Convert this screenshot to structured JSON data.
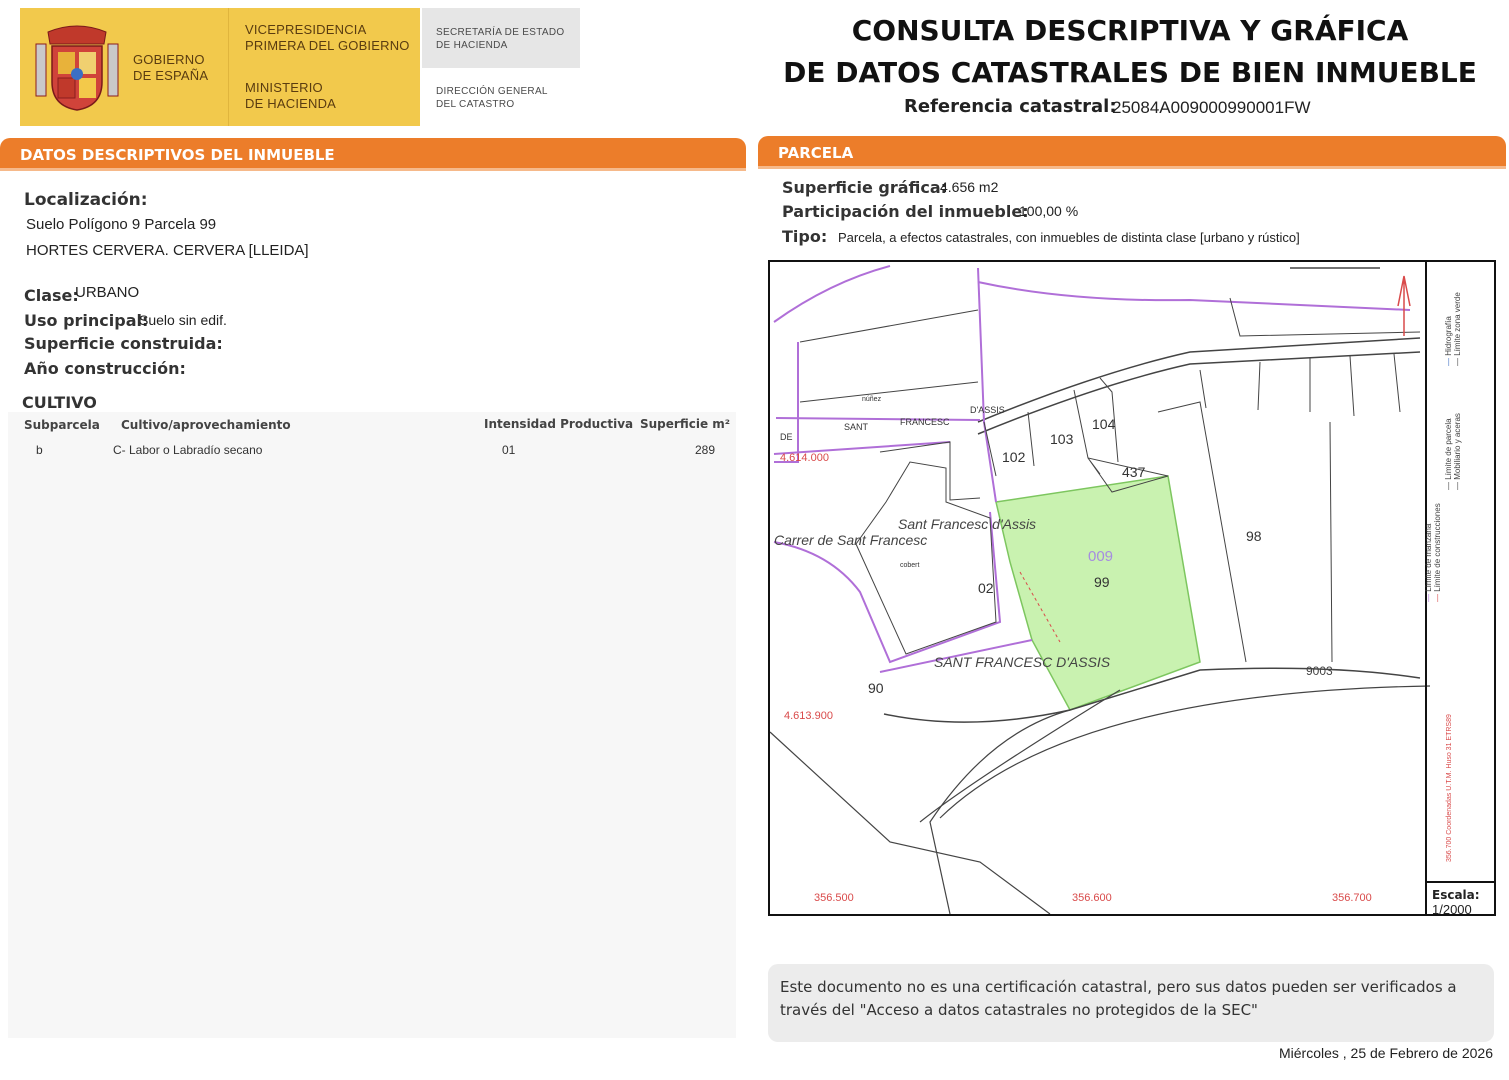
{
  "header": {
    "gov_name_1": "GOBIERNO",
    "gov_name_2": "DE ESPAÑA",
    "vice_1": "VICEPRESIDENCIA",
    "vice_2": "PRIMERA DEL GOBIERNO",
    "min_1": "MINISTERIO",
    "min_2": "DE HACIENDA",
    "sec_1": "SECRETARÍA DE ESTADO",
    "sec_2": "DE HACIENDA",
    "dir_1": "DIRECCIÓN GENERAL",
    "dir_2": "DEL CATASTRO",
    "title_1": "CONSULTA DESCRIPTIVA Y GRÁFICA",
    "title_2": "DE DATOS CATASTRALES DE BIEN INMUEBLE",
    "ref_label": "Referencia catastral:",
    "ref_value": "25084A009000990001FW"
  },
  "left": {
    "section_title": "DATOS DESCRIPTIVOS DEL INMUEBLE",
    "loc_label": "Localización:",
    "loc_line1": "Suelo Polígono 9 Parcela 99",
    "loc_line2": "HORTES CERVERA. CERVERA [LLEIDA]",
    "clase_label": "Clase:",
    "clase_value": "URBANO",
    "uso_label": "Uso principal:",
    "uso_value": "Suelo sin edif.",
    "sup_label": "Superficie construida:",
    "anio_label": "Año construcción:",
    "cultivo_title": "CULTIVO",
    "table_headers": [
      "Subparcela",
      "Cultivo/aprovechamiento",
      "Intensidad Productiva",
      "Superficie m²"
    ],
    "table_rows": [
      [
        "b",
        "C- Labor o Labradío secano",
        "01",
        "289"
      ]
    ]
  },
  "right": {
    "section_title": "PARCELA",
    "supg_label": "Superficie gráfica:",
    "supg_value": "4.656 m2",
    "part_label": "Participación del inmueble:",
    "part_value": "100,00 %",
    "tipo_label": "Tipo:",
    "tipo_value": "Parcela, a efectos catastrales, con inmuebles de distinta clase [urbano y rústico]"
  },
  "map": {
    "parcel_numbers": [
      "102",
      "103",
      "104",
      "437",
      "98",
      "02",
      "90",
      "99",
      "009"
    ],
    "street_labels": [
      "SANT FRANCESC D'ASSIS",
      "Sant Francesc d'Assis",
      "Carrer de Sant Francesc",
      "SANT",
      "FRANCESC",
      "D'ASSIS",
      "DE"
    ],
    "coord_labels": [
      "356.500",
      "356.600",
      "356.700",
      "4.613.900",
      "4.614.000"
    ],
    "small_labels": [
      "núñez",
      "cobert"
    ],
    "road_label": "9003",
    "legend_items": [
      "Límite de manzana",
      "Límite de parcela",
      "Límite de construcciones",
      "Mobiliario y aceras",
      "Límite zona verde",
      "Hidrografía"
    ],
    "legend_coords": "356.700 Coordenadas U.T.M. Huso 31 ETRS89",
    "scale_label": "Escala:",
    "scale_value": "1/2000",
    "colors": {
      "parcel_fill": "#c9f2b0",
      "boundary": "#b06fd8",
      "coord_text": "#d94a4a"
    }
  },
  "footer": {
    "notice": "Este documento no es una certificación catastral, pero sus datos pueden ser verificados a través del \"Acceso a datos catastrales no protegidos de la SEC\"",
    "date": "Miércoles , 25 de Febrero de 2026"
  }
}
